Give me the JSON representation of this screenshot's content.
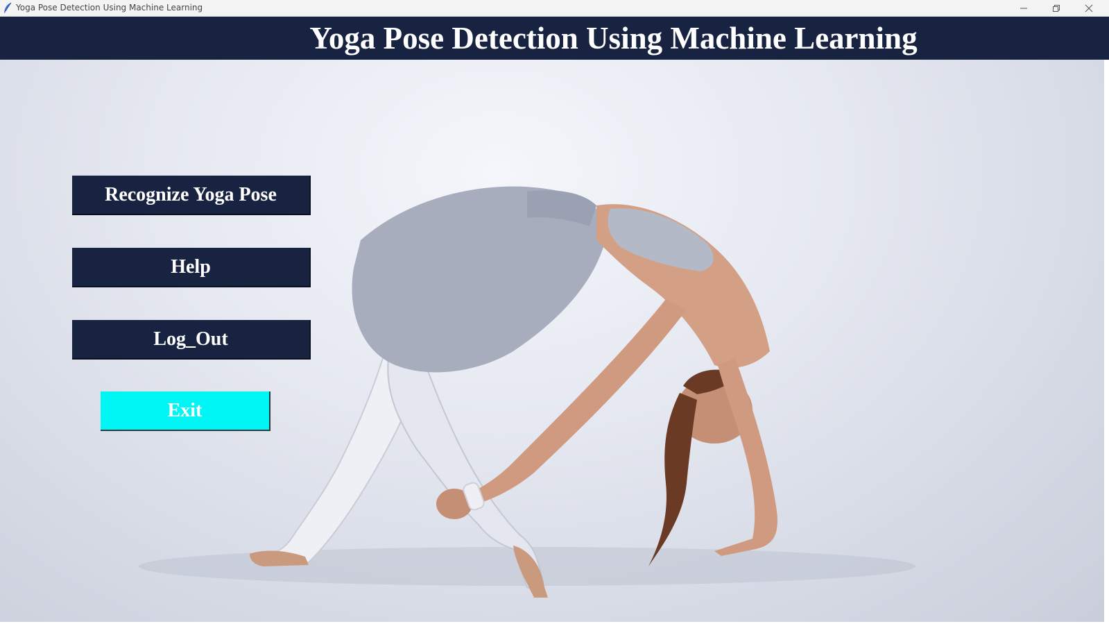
{
  "window": {
    "title": "Yoga Pose Detection Using Machine Learning"
  },
  "header": {
    "title": "Yoga Pose Detection Using Machine Learning"
  },
  "menu": {
    "recognize_label": "Recognize Yoga Pose",
    "help_label": "Help",
    "logout_label": "Log_Out",
    "exit_label": "Exit"
  },
  "colors": {
    "header_bg": "#172340",
    "button_bg": "#172340",
    "exit_bg": "#00f5f5",
    "button_text": "#ffffff"
  },
  "icons": {
    "app": "feather-icon",
    "minimize": "minimize-icon",
    "maximize": "restore-icon",
    "close": "close-icon"
  }
}
